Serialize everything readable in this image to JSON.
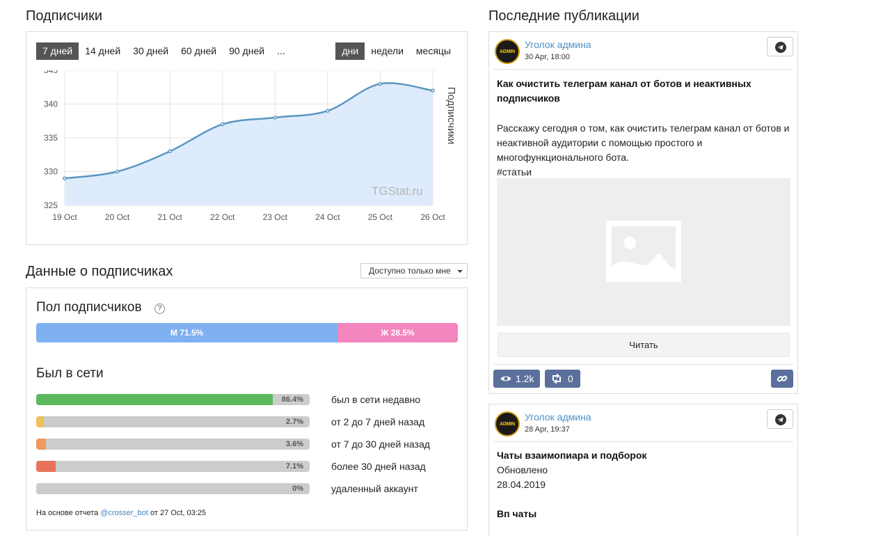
{
  "subscribers": {
    "title": "Подписчики",
    "period_tabs": [
      "7 дней",
      "14 дней",
      "30 дней",
      "60 дней",
      "90 дней",
      "..."
    ],
    "active_period": "7 дней",
    "granularity_tabs": [
      "дни",
      "недели",
      "месяцы"
    ],
    "active_granularity": "дни"
  },
  "chart_data": {
    "type": "area",
    "x": [
      "19 Oct",
      "20 Oct",
      "21 Oct",
      "22 Oct",
      "23 Oct",
      "24 Oct",
      "25 Oct",
      "26 Oct"
    ],
    "series": [
      {
        "values": [
          329,
          330,
          333,
          337,
          338,
          339,
          343,
          342
        ]
      }
    ],
    "ylabel": "Подписчики",
    "ylim": [
      325,
      345
    ],
    "yticks": [
      325,
      330,
      335,
      340,
      345
    ],
    "grid": true,
    "watermark": "TGStat.ru",
    "line_color": "#5a96c0",
    "fill_color": "#deebfc"
  },
  "subscriber_data": {
    "title": "Данные о подписчиках",
    "privacy_select": "Доступно только мне",
    "gender": {
      "title": "Пол подписчиков",
      "help_icon": "question-circle-icon",
      "male_label": "М 71.5%",
      "female_label": "Ж 28.5%",
      "male_fraction": 0.715,
      "female_fraction": 0.285
    },
    "online": {
      "title": "Был в сети",
      "rows": [
        {
          "pct_label": "86.4%",
          "value": 86.4,
          "label": "был в сети недавно",
          "color": "#5cb85c"
        },
        {
          "pct_label": "2.7%",
          "value": 2.7,
          "label": "от 2 до 7 дней назад",
          "color": "#f0c05a"
        },
        {
          "pct_label": "3.6%",
          "value": 3.6,
          "label": "от 7 до 30 дней назад",
          "color": "#ee9a5c"
        },
        {
          "pct_label": "7.1%",
          "value": 7.1,
          "label": "более 30 дней назад",
          "color": "#e8735a"
        },
        {
          "pct_label": "0%",
          "value": 0,
          "label": "удаленный аккаунт",
          "color": "#999999"
        }
      ]
    },
    "report_note": {
      "prefix": "На основе отчета ",
      "bot": "@crosser_bot",
      "suffix": " от 27 Oct, 03:25"
    }
  },
  "recent_posts": {
    "title": "Последние публикации",
    "posts": [
      {
        "author": "Уголок админа",
        "avatar_text": "ADMIN",
        "date": "30 Apr, 18:00",
        "title": "Как очистить телеграм канал от ботов и неактивных подписчиков",
        "text": "Расскажу сегодня о том, как очистить телеграм канал от ботов и неактивной аудитории с помощью простого и многофункционального бота.",
        "hashtag": "#статьи",
        "read_label": "Читать",
        "views": "1.2k",
        "shares": "0"
      },
      {
        "author": "Уголок админа",
        "avatar_text": "ADMIN",
        "date": "28 Apr, 19:37",
        "title": "Чаты взаимопиара и подборок",
        "line1": "Обновлено",
        "line2": "28.04.2019",
        "subtitle": "Вп чаты"
      }
    ]
  }
}
